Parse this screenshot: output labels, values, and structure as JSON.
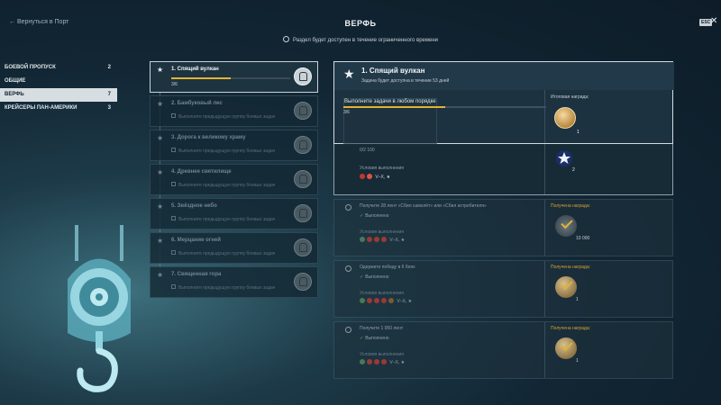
{
  "header": {
    "back_label": "← Вернуться в Порт",
    "title": "ВЕРФЬ",
    "notice": "Раздел будет доступен в течение ограниченного времени",
    "esc_label": "ESC",
    "close_label": "✕"
  },
  "categories": [
    {
      "label": "БОЕВОЙ ПРОПУСК",
      "count": "2"
    },
    {
      "label": "ОБЩИЕ",
      "count": ""
    },
    {
      "label": "ВЕРФЬ",
      "count": "7"
    },
    {
      "label": "КРЕЙСЕРЫ ПАН-АМЕРИКИ",
      "count": "3"
    }
  ],
  "stages": [
    {
      "name": "1. Спящий вулкан",
      "progress": "3/6",
      "progress_fraction": 0.5
    },
    {
      "name": "2. Бамбуковый лес",
      "subtitle": "Выполните предыдущую группу боевых задач"
    },
    {
      "name": "3. Дорога к великому храму",
      "subtitle": "Выполните предыдущую группу боевых задач"
    },
    {
      "name": "4. Древнее святилище",
      "subtitle": "Выполните предыдущую группу боевых задач"
    },
    {
      "name": "5. Звёздное небо",
      "subtitle": "Выполните предыдущую группу боевых задач"
    },
    {
      "name": "6. Мерцание огней",
      "subtitle": "Выполните предыдущую группу боевых задач"
    },
    {
      "name": "7. Священная гора",
      "subtitle": "Выполните предыдущую группу боевых задач"
    }
  ],
  "detail": {
    "title": "1. Спящий вулкан",
    "time": "Задача будет доступна в течение 53 дней",
    "task": "Выполните задачи в любом порядке",
    "progress": "3/6",
    "progress_fraction": 0.5,
    "reward_label": "Итоговая награда:",
    "reward_count": "1"
  },
  "block1": {
    "progress": "0/2 100",
    "cond_label": "Условия выполнения",
    "tier": "V–X, ★",
    "reward_count": "2"
  },
  "tasks": [
    {
      "title": "Получите 28 лент «Сбил самолёт» или «Сбил истребителя»",
      "done": "Выполнено",
      "cond_label": "Условия выполнения",
      "tier": "V–X, ★",
      "reward_label": "Получена награда:",
      "reward_count": "10 000"
    },
    {
      "title": "Одержите победу в 6 боях",
      "done": "Выполнено",
      "cond_label": "Условия выполнения",
      "tier": "V–X, ★",
      "reward_label": "Получена награда:",
      "reward_count": "1"
    },
    {
      "title": "Получите 1 050 лент",
      "done": "Выполнено",
      "cond_label": "Условия выполнения",
      "tier": "V–X, ★",
      "reward_label": "Получена награда:",
      "reward_count": "1"
    }
  ],
  "colors": {
    "accent": "#e2b335",
    "active_bg": "#d7dee2"
  }
}
